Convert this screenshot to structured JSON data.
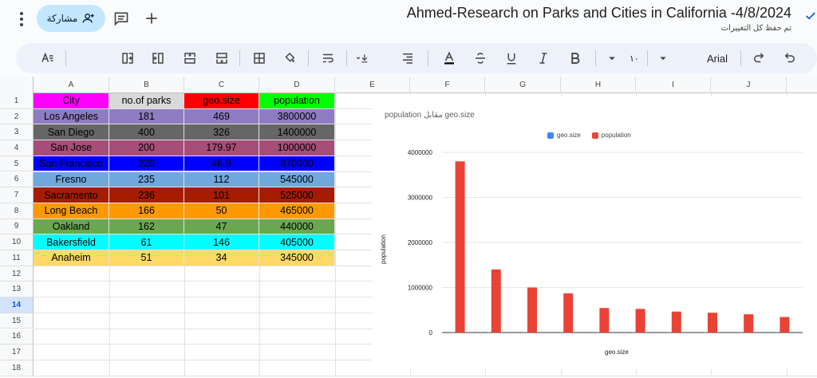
{
  "header": {
    "share_label": "مشاركة",
    "title": "Ahmed-Research on Parks and Cities in California -4/8/2024",
    "saved_status": "تم حفظ كل التغييرات"
  },
  "toolbar": {
    "font_name": "Arial",
    "font_size": "١٠"
  },
  "sheet": {
    "columns": [
      "A",
      "B",
      "C",
      "D",
      "E",
      "F",
      "G",
      "H",
      "I",
      "J"
    ],
    "rows": [
      "1",
      "2",
      "3",
      "4",
      "5",
      "6",
      "7",
      "8",
      "9",
      "10",
      "11",
      "12",
      "13",
      "14",
      "15",
      "16",
      "17",
      "18"
    ],
    "selected_row": "14",
    "headers": [
      "City",
      "no.of parks",
      "geo.size",
      "population"
    ],
    "header_colors": [
      "#ff00ff",
      "#d9d9d9",
      "#ff0000",
      "#00ff00"
    ],
    "data": [
      {
        "city": "Los Angeles",
        "parks": "181",
        "geo": "469",
        "pop": "3800000",
        "color": "#8e7cc3"
      },
      {
        "city": "San Diego",
        "parks": "400",
        "geo": "326",
        "pop": "1400000",
        "color": "#666666"
      },
      {
        "city": "San Jose",
        "parks": "200",
        "geo": "179.97",
        "pop": "1000000",
        "color": "#a64d79"
      },
      {
        "city": "San Francisco",
        "parks": "220",
        "geo": "46.9",
        "pop": "870000",
        "color": "#0000ff"
      },
      {
        "city": "Fresno",
        "parks": "235",
        "geo": "112",
        "pop": "545000",
        "color": "#6fa8dc"
      },
      {
        "city": "Sacramento",
        "parks": "236",
        "geo": "101",
        "pop": "525000",
        "color": "#a61c00"
      },
      {
        "city": "Long Beach",
        "parks": "166",
        "geo": "50",
        "pop": "465000",
        "color": "#ff9900"
      },
      {
        "city": "Oakland",
        "parks": "162",
        "geo": "47",
        "pop": "440000",
        "color": "#6aa84f"
      },
      {
        "city": "Bakersfield",
        "parks": "61",
        "geo": "146",
        "pop": "405000",
        "color": "#00ffff"
      },
      {
        "city": "Anaheim",
        "parks": "51",
        "geo": "34",
        "pop": "345000",
        "color": "#ffd966"
      }
    ]
  },
  "chart_data": {
    "type": "bar",
    "title": "population مقابل geo.size",
    "xlabel": "geo.size",
    "ylabel": "population",
    "ylim": [
      0,
      4000000
    ],
    "yticks": [
      "0",
      "1000000",
      "2000000",
      "3000000",
      "4000000"
    ],
    "legend_position": "top",
    "series": [
      {
        "name": "geo.size",
        "color": "#4285f4",
        "values": [
          469,
          326,
          179.97,
          46.9,
          112,
          101,
          50,
          47,
          146,
          34
        ]
      },
      {
        "name": "population",
        "color": "#ea4335",
        "values": [
          3800000,
          1400000,
          1000000,
          870000,
          545000,
          525000,
          465000,
          440000,
          405000,
          345000
        ]
      }
    ],
    "grid": true
  }
}
